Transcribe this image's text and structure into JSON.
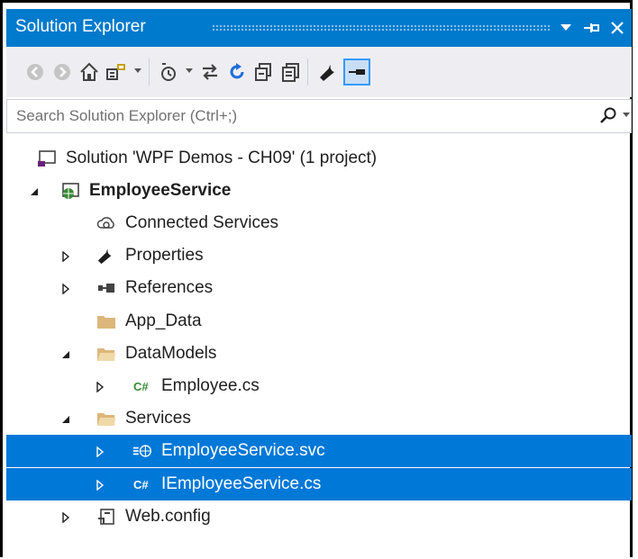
{
  "panel": {
    "title": "Solution Explorer",
    "window_buttons": [
      {
        "name": "dropdown-icon",
        "glyph": "▼"
      },
      {
        "name": "pin-icon",
        "glyph": "⊣"
      },
      {
        "name": "close-icon",
        "glyph": "✕"
      }
    ]
  },
  "toolbar": {
    "tools": [
      {
        "name": "back-icon"
      },
      {
        "name": "forward-icon"
      },
      {
        "name": "home-icon"
      },
      {
        "name": "switch-views-icon"
      },
      {
        "name": "pending-changes-filter-icon"
      },
      {
        "name": "sync-with-active-document-icon"
      },
      {
        "name": "refresh-icon"
      },
      {
        "name": "collapse-all-icon"
      },
      {
        "name": "show-all-files-icon"
      },
      {
        "name": "properties-icon"
      },
      {
        "name": "preview-selected-items-icon"
      }
    ]
  },
  "search": {
    "placeholder": "Search Solution Explorer (Ctrl+;)",
    "value": ""
  },
  "colors": {
    "accent": "#007acc",
    "selection": "#0078d7",
    "toolbar_bg": "#eeeef2",
    "folder": "#dcb67a",
    "csharp": "#388a34"
  },
  "tree": [
    {
      "label": "Solution 'WPF Demos - CH09' (1 project)",
      "icon": "solution-icon",
      "expander": "none",
      "bold": false,
      "selected": false
    },
    {
      "label": "EmployeeService",
      "icon": "web-project-icon",
      "expander": "expanded",
      "bold": true,
      "selected": false
    },
    {
      "label": "Connected Services",
      "icon": "connected-services-icon",
      "expander": "none",
      "bold": false,
      "selected": false
    },
    {
      "label": "Properties",
      "icon": "wrench-icon",
      "expander": "collapsed",
      "bold": false,
      "selected": false
    },
    {
      "label": "References",
      "icon": "references-icon",
      "expander": "collapsed",
      "bold": false,
      "selected": false
    },
    {
      "label": "App_Data",
      "icon": "folder-icon",
      "expander": "none",
      "bold": false,
      "selected": false
    },
    {
      "label": "DataModels",
      "icon": "folder-open-icon",
      "expander": "expanded",
      "bold": false,
      "selected": false
    },
    {
      "label": "Employee.cs",
      "icon": "csharp-file-icon",
      "expander": "collapsed",
      "bold": false,
      "selected": false
    },
    {
      "label": "Services",
      "icon": "folder-open-icon",
      "expander": "expanded",
      "bold": false,
      "selected": false
    },
    {
      "label": "EmployeeService.svc",
      "icon": "wcf-service-icon",
      "expander": "collapsed",
      "bold": false,
      "selected": true
    },
    {
      "label": "IEmployeeService.cs",
      "icon": "csharp-file-icon",
      "expander": "collapsed",
      "bold": false,
      "selected": true
    },
    {
      "label": "Web.config",
      "icon": "config-file-icon",
      "expander": "collapsed",
      "bold": false,
      "selected": false
    }
  ]
}
